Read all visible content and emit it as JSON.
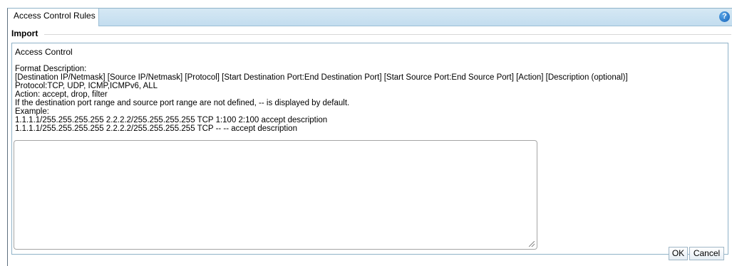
{
  "tabs": {
    "active_label": "Access Control Rules",
    "help_symbol": "?"
  },
  "legend": "Import",
  "section": {
    "title": "Access Control"
  },
  "description": {
    "lines": [
      "Format Description:",
      "[Destination IP/Netmask] [Source IP/Netmask] [Protocol] [Start Destination Port:End Destination Port] [Start Source Port:End Source Port] [Action] [Description (optional)]",
      "Protocol:TCP, UDP, ICMP,ICMPv6, ALL",
      "Action: accept, drop, filter",
      "If the destination port range and source port range are not defined, -- is displayed by default.",
      "Example:",
      "1.1.1.1/255.255.255.255 2.2.2.2/255.255.255.255 TCP 1:100 2:100 accept description",
      "1.1.1.1/255.255.255.255 2.2.2.2/255.255.255.255 TCP -- -- accept description"
    ]
  },
  "rules_input": {
    "value": ""
  },
  "buttons": {
    "ok": "OK",
    "cancel": "Cancel"
  },
  "colors": {
    "tab_bar": "#c8e0f0",
    "border": "#8fb2c8",
    "help_icon": "#1f73c8"
  }
}
